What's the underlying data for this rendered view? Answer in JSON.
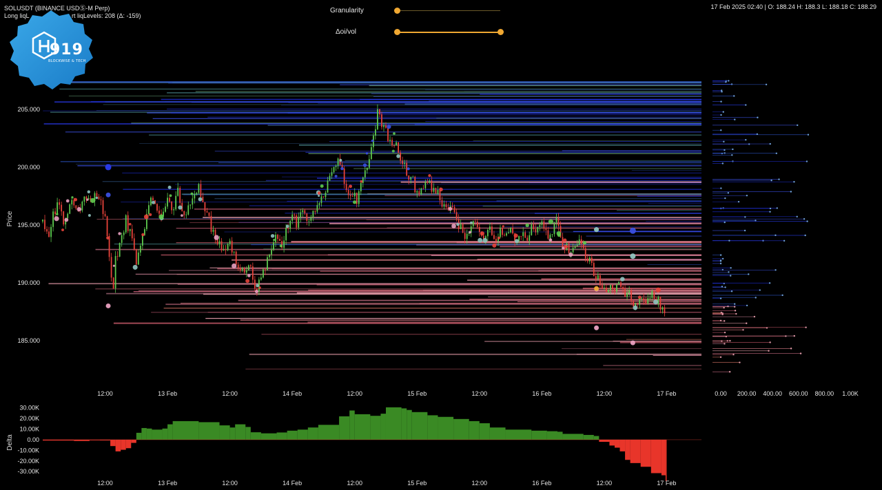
{
  "header": {
    "symbol": "SOLUSDT (BINANCE USDⓈ-M Perp)",
    "levels_left": "Long liqL",
    "levels_right": "rt liqLevels: 208 (Δ: -159)",
    "ohlc": "17 Feb 2025 02:40 | O: 188.24 H: 188.3 L: 188.18 C: 188.29"
  },
  "logo": {
    "number": "919",
    "tagline": "BLOCKWISE & TECH"
  },
  "controls": {
    "granularity_label": "Granularity",
    "granularity_value": 0,
    "oivol_label": "Δoi/vol",
    "oivol_range": [
      0,
      1
    ],
    "accent": "#f0a832"
  },
  "chart_data": [
    {
      "type": "candlestick",
      "title": "",
      "ylabel": "Price",
      "ylim": [
        181,
        209.7
      ],
      "y_ticks": [
        205,
        200,
        195,
        190,
        185
      ],
      "y_tick_labels": [
        "205.000",
        "200.000",
        "195.000",
        "190.000",
        "185.000"
      ],
      "x_tick_labels": [
        "12:00",
        "13 Feb",
        "12:00",
        "14 Feb",
        "12:00",
        "15 Feb",
        "12:00",
        "16 Feb",
        "12:00",
        "17 Feb"
      ],
      "x_ticks_hours": [
        12,
        24,
        36,
        48,
        60,
        72,
        84,
        96,
        108,
        120
      ],
      "x_range_hours": [
        0,
        126.7
      ],
      "x_origin": "12 Feb 00:00",
      "up_color": "#5ecb4e",
      "down_color": "#e8433a",
      "price_path": [
        [
          0,
          195.3
        ],
        [
          1,
          194.0
        ],
        [
          2,
          195.8
        ],
        [
          3,
          196.8
        ],
        [
          4,
          195.2
        ],
        [
          5,
          196.5
        ],
        [
          6,
          197.0
        ],
        [
          7,
          196.0
        ],
        [
          8,
          197.4
        ],
        [
          9,
          196.8
        ],
        [
          10,
          198.0
        ],
        [
          11,
          197.2
        ],
        [
          12,
          195.5
        ],
        [
          13,
          191.5
        ],
        [
          13.5,
          189.4
        ],
        [
          14,
          192.0
        ],
        [
          15,
          193.5
        ],
        [
          16,
          195.5
        ],
        [
          17,
          194.0
        ],
        [
          18,
          191.5
        ],
        [
          19,
          193.5
        ],
        [
          20,
          195.8
        ],
        [
          21,
          197.2
        ],
        [
          22,
          196.0
        ],
        [
          23,
          195.2
        ],
        [
          24,
          197.8
        ],
        [
          25,
          196.3
        ],
        [
          26,
          197.8
        ],
        [
          27,
          195.5
        ],
        [
          28,
          196.8
        ],
        [
          29,
          197.6
        ],
        [
          30,
          198.2
        ],
        [
          31,
          196.2
        ],
        [
          32,
          195.4
        ],
        [
          33,
          194.0
        ],
        [
          34,
          193.6
        ],
        [
          35,
          192.5
        ],
        [
          36,
          193.3
        ],
        [
          37,
          192.1
        ],
        [
          38,
          191.2
        ],
        [
          39,
          190.5
        ],
        [
          40,
          191.5
        ],
        [
          41,
          189.4
        ],
        [
          42,
          190.5
        ],
        [
          43,
          191.8
        ],
        [
          44,
          193.2
        ],
        [
          45,
          194.4
        ],
        [
          46,
          193.2
        ],
        [
          47,
          194.8
        ],
        [
          48,
          195.8
        ],
        [
          49,
          195.0
        ],
        [
          50,
          196.2
        ],
        [
          51,
          195.0
        ],
        [
          52,
          195.8
        ],
        [
          53,
          196.8
        ],
        [
          54,
          197.8
        ],
        [
          55,
          198.6
        ],
        [
          56,
          200.0
        ],
        [
          57,
          200.5
        ],
        [
          58,
          199.0
        ],
        [
          59,
          197.2
        ],
        [
          60,
          198.0
        ],
        [
          60.5,
          196.8
        ],
        [
          61,
          198.8
        ],
        [
          62,
          199.8
        ],
        [
          63,
          201.2
        ],
        [
          64,
          203.4
        ],
        [
          64.5,
          205.3
        ],
        [
          65,
          203.6
        ],
        [
          66,
          203.0
        ],
        [
          67,
          202.1
        ],
        [
          68,
          201.8
        ],
        [
          69,
          200.5
        ],
        [
          70,
          199.6
        ],
        [
          71,
          199.0
        ],
        [
          72,
          197.6
        ],
        [
          73,
          198.4
        ],
        [
          74,
          198.8
        ],
        [
          75,
          198.0
        ],
        [
          76,
          197.8
        ],
        [
          77,
          196.8
        ],
        [
          78,
          196.6
        ],
        [
          79,
          196.0
        ],
        [
          80,
          195.0
        ],
        [
          81,
          194.2
        ],
        [
          82,
          194.0
        ],
        [
          83,
          195.2
        ],
        [
          84,
          194.2
        ],
        [
          85,
          193.6
        ],
        [
          86,
          194.6
        ],
        [
          87,
          193.4
        ],
        [
          88,
          194.4
        ],
        [
          89,
          193.8
        ],
        [
          90,
          194.8
        ],
        [
          91,
          193.4
        ],
        [
          92,
          194.4
        ],
        [
          93,
          193.7
        ],
        [
          94,
          194.8
        ],
        [
          95,
          194.5
        ],
        [
          96,
          195.0
        ],
        [
          97,
          194.0
        ],
        [
          98,
          194.6
        ],
        [
          99,
          195.5
        ],
        [
          100,
          192.8
        ],
        [
          101,
          193.0
        ],
        [
          102,
          192.6
        ],
        [
          103,
          193.6
        ],
        [
          104,
          192.6
        ],
        [
          105,
          192.0
        ],
        [
          106,
          191.0
        ],
        [
          107,
          190.0
        ],
        [
          108,
          189.5
        ],
        [
          109,
          189.8
        ],
        [
          110,
          189.4
        ],
        [
          111,
          190.2
        ],
        [
          112,
          189.2
        ],
        [
          113,
          189.0
        ],
        [
          114,
          187.8
        ],
        [
          115,
          188.9
        ],
        [
          116,
          188.4
        ],
        [
          117,
          189.1
        ],
        [
          118,
          188.6
        ],
        [
          119,
          188.0
        ],
        [
          119.7,
          187.1
        ],
        [
          120,
          187.8
        ]
      ]
    },
    {
      "type": "bar",
      "title": "",
      "ylabel": "Delta",
      "ylim": [
        -37000,
        33000
      ],
      "y_ticks": [
        30000,
        20000,
        10000,
        0,
        -10000,
        -20000,
        -30000
      ],
      "y_tick_labels": [
        "30.00K",
        "20.00K",
        "10.00K",
        "0.00",
        "-10.00K",
        "-20.00K",
        "-30.00K"
      ],
      "x_tick_labels": [
        "12:00",
        "13 Feb",
        "12:00",
        "14 Feb",
        "12:00",
        "15 Feb",
        "12:00",
        "16 Feb",
        "12:00",
        "17 Feb"
      ],
      "pos_color": "#3a8a24",
      "neg_color": "#e8352a",
      "values": [
        [
          0,
          -800
        ],
        [
          6,
          -1200
        ],
        [
          9,
          -600
        ],
        [
          11,
          -700
        ],
        [
          13,
          -6000
        ],
        [
          14,
          -11000
        ],
        [
          15,
          -9500
        ],
        [
          16,
          -8000
        ],
        [
          17,
          -3000
        ],
        [
          18,
          6500
        ],
        [
          19,
          11000
        ],
        [
          20,
          10500
        ],
        [
          21,
          9500
        ],
        [
          23,
          10500
        ],
        [
          24,
          14500
        ],
        [
          25,
          17500
        ],
        [
          30,
          16500
        ],
        [
          34,
          13500
        ],
        [
          36,
          11500
        ],
        [
          37,
          14500
        ],
        [
          39,
          12000
        ],
        [
          40,
          7000
        ],
        [
          42,
          6000
        ],
        [
          45,
          6800
        ],
        [
          47,
          8500
        ],
        [
          49,
          9500
        ],
        [
          51,
          11500
        ],
        [
          53,
          14000
        ],
        [
          57,
          22000
        ],
        [
          59,
          27500
        ],
        [
          60,
          24000
        ],
        [
          63,
          22500
        ],
        [
          65,
          24500
        ],
        [
          66,
          30500
        ],
        [
          69,
          29500
        ],
        [
          70,
          28000
        ],
        [
          71,
          26000
        ],
        [
          74,
          23000
        ],
        [
          76,
          21500
        ],
        [
          79,
          19500
        ],
        [
          82,
          17500
        ],
        [
          84,
          15500
        ],
        [
          86,
          11500
        ],
        [
          89,
          9500
        ],
        [
          94,
          8500
        ],
        [
          97,
          8000
        ],
        [
          99,
          7500
        ],
        [
          100,
          5500
        ],
        [
          104,
          4500
        ],
        [
          106,
          3500
        ],
        [
          107,
          -2000
        ],
        [
          109,
          -5500
        ],
        [
          110,
          -7500
        ],
        [
          111,
          -11000
        ],
        [
          112,
          -19000
        ],
        [
          113,
          -22000
        ],
        [
          115,
          -25500
        ],
        [
          117,
          -31500
        ],
        [
          119,
          -33500
        ],
        [
          119.8,
          -39000
        ]
      ]
    },
    {
      "type": "bar",
      "orientation": "horizontal",
      "title": "",
      "x_tick_labels": [
        "0.00",
        "200.00",
        "400.00",
        "600.00",
        "800.00",
        "1.00K"
      ],
      "x_ticks": [
        0,
        200,
        400,
        600,
        800,
        1000
      ],
      "xlim": [
        -60,
        1300
      ]
    }
  ]
}
